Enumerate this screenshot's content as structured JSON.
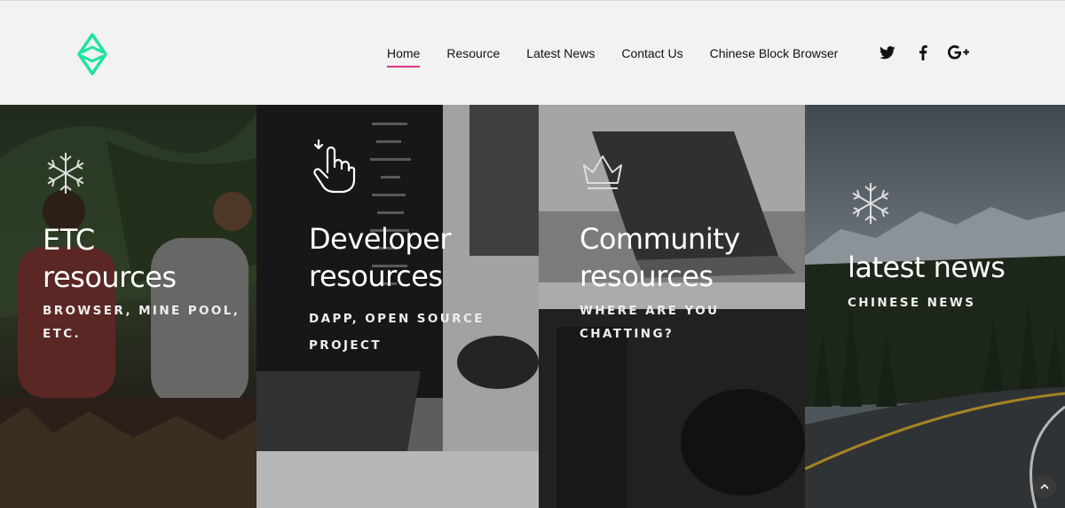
{
  "header": {
    "nav": [
      {
        "label": "Home",
        "active": true
      },
      {
        "label": "Resource"
      },
      {
        "label": "Latest News"
      },
      {
        "label": "Contact Us"
      },
      {
        "label": "Chinese Block Browser"
      }
    ],
    "social": [
      "twitter-icon",
      "facebook-icon",
      "google-plus-icon"
    ],
    "accent": "#e0338b",
    "logo_color": "#1ee3a0"
  },
  "panels": [
    {
      "icon": "snowflake-icon",
      "title_line1": "ETC",
      "title_line2": "resources",
      "subtitle_line1": "BROWSER, MINE POOL,",
      "subtitle_line2": "ETC."
    },
    {
      "icon": "hand-pointer-icon",
      "title_line1": "Developer",
      "title_line2": "resources",
      "subtitle_line1": "DAPP, OPEN SOURCE",
      "subtitle_line2": "PROJECT"
    },
    {
      "icon": "crown-icon",
      "title_line1": "Community",
      "title_line2": "resources",
      "subtitle_line1": "WHERE ARE YOU",
      "subtitle_line2": "CHATTING?"
    },
    {
      "icon": "snowflake-icon",
      "title_line1": "latest news",
      "subtitle_line1": "CHINESE NEWS"
    }
  ]
}
